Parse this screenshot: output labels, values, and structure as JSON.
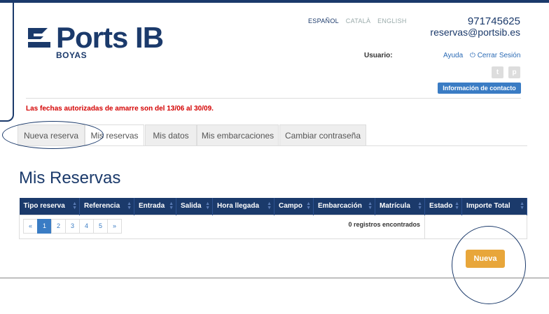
{
  "brand": {
    "name": "Ports IB",
    "sub": "BOYAS",
    "color": "#1b3a6b"
  },
  "languages": [
    {
      "label": "ESPAÑOL",
      "active": true
    },
    {
      "label": "CATALÀ",
      "active": false
    },
    {
      "label": "ENGLISH",
      "active": false
    }
  ],
  "contact": {
    "phone": "971745625",
    "email": "reservas@portsib.es"
  },
  "user": {
    "label": "Usuario:",
    "value": ""
  },
  "links": {
    "help": "Ayuda",
    "logout": "Cerrar Sesión",
    "logout_icon": "power-icon"
  },
  "social": [
    {
      "icon": "twitter-icon",
      "glyph": "t"
    },
    {
      "icon": "pinterest-icon",
      "glyph": "p"
    }
  ],
  "contact_button": "Información de contacto",
  "notice": "Las fechas autorizadas de amarre son del 13/06 al 30/09.",
  "tabs": [
    {
      "label": "Nueva reserva",
      "active": false
    },
    {
      "label": "Mis reservas",
      "active": true
    },
    {
      "label": "Mis datos",
      "active": false
    },
    {
      "label": "Mis embarcaciones",
      "active": false
    },
    {
      "label": "Cambiar contraseña",
      "active": false
    }
  ],
  "page_title": "Mis Reservas",
  "table": {
    "columns": [
      "Tipo reserva",
      "Referencia",
      "Entrada",
      "Salida",
      "Hora llegada",
      "Campo",
      "Embarcación",
      "Matrícula",
      "Estado",
      "Importe Total"
    ],
    "pager": [
      "«",
      "1",
      "2",
      "3",
      "4",
      "5",
      "»"
    ],
    "pager_active": 1,
    "records": "0 registros encontrados"
  },
  "new_button": "Nueva",
  "colors": {
    "accent": "#3a7cc4",
    "warning": "#e8a63a",
    "notice": "#d40000"
  }
}
